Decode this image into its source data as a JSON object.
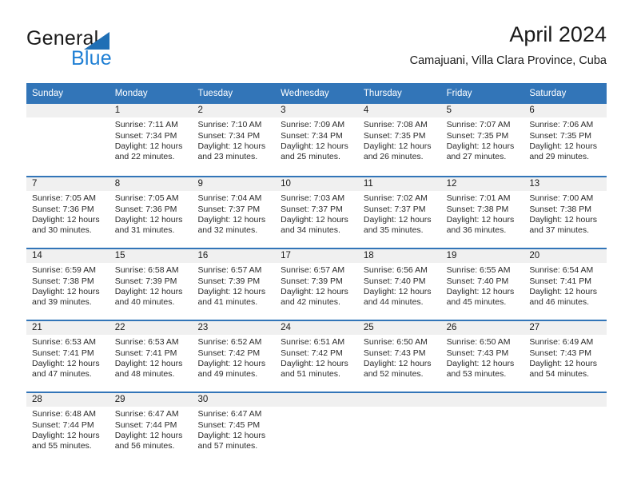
{
  "brand": {
    "name_dark": "General",
    "name_blue": "Blue",
    "triangle_color": "#1f6fb5",
    "blue_color": "#1f7fd4"
  },
  "header": {
    "title": "April 2024",
    "subtitle": "Camajuani, Villa Clara Province, Cuba"
  },
  "theme": {
    "header_blue": "#3275b8",
    "daynum_bg": "#f0f0f0",
    "text": "#1a1a1a"
  },
  "weekdays": [
    "Sunday",
    "Monday",
    "Tuesday",
    "Wednesday",
    "Thursday",
    "Friday",
    "Saturday"
  ],
  "weeks": [
    [
      {
        "day": "",
        "sunrise": "",
        "sunset": "",
        "daylight1": "",
        "daylight2": ""
      },
      {
        "day": "1",
        "sunrise": "Sunrise: 7:11 AM",
        "sunset": "Sunset: 7:34 PM",
        "daylight1": "Daylight: 12 hours",
        "daylight2": "and 22 minutes."
      },
      {
        "day": "2",
        "sunrise": "Sunrise: 7:10 AM",
        "sunset": "Sunset: 7:34 PM",
        "daylight1": "Daylight: 12 hours",
        "daylight2": "and 23 minutes."
      },
      {
        "day": "3",
        "sunrise": "Sunrise: 7:09 AM",
        "sunset": "Sunset: 7:34 PM",
        "daylight1": "Daylight: 12 hours",
        "daylight2": "and 25 minutes."
      },
      {
        "day": "4",
        "sunrise": "Sunrise: 7:08 AM",
        "sunset": "Sunset: 7:35 PM",
        "daylight1": "Daylight: 12 hours",
        "daylight2": "and 26 minutes."
      },
      {
        "day": "5",
        "sunrise": "Sunrise: 7:07 AM",
        "sunset": "Sunset: 7:35 PM",
        "daylight1": "Daylight: 12 hours",
        "daylight2": "and 27 minutes."
      },
      {
        "day": "6",
        "sunrise": "Sunrise: 7:06 AM",
        "sunset": "Sunset: 7:35 PM",
        "daylight1": "Daylight: 12 hours",
        "daylight2": "and 29 minutes."
      }
    ],
    [
      {
        "day": "7",
        "sunrise": "Sunrise: 7:05 AM",
        "sunset": "Sunset: 7:36 PM",
        "daylight1": "Daylight: 12 hours",
        "daylight2": "and 30 minutes."
      },
      {
        "day": "8",
        "sunrise": "Sunrise: 7:05 AM",
        "sunset": "Sunset: 7:36 PM",
        "daylight1": "Daylight: 12 hours",
        "daylight2": "and 31 minutes."
      },
      {
        "day": "9",
        "sunrise": "Sunrise: 7:04 AM",
        "sunset": "Sunset: 7:37 PM",
        "daylight1": "Daylight: 12 hours",
        "daylight2": "and 32 minutes."
      },
      {
        "day": "10",
        "sunrise": "Sunrise: 7:03 AM",
        "sunset": "Sunset: 7:37 PM",
        "daylight1": "Daylight: 12 hours",
        "daylight2": "and 34 minutes."
      },
      {
        "day": "11",
        "sunrise": "Sunrise: 7:02 AM",
        "sunset": "Sunset: 7:37 PM",
        "daylight1": "Daylight: 12 hours",
        "daylight2": "and 35 minutes."
      },
      {
        "day": "12",
        "sunrise": "Sunrise: 7:01 AM",
        "sunset": "Sunset: 7:38 PM",
        "daylight1": "Daylight: 12 hours",
        "daylight2": "and 36 minutes."
      },
      {
        "day": "13",
        "sunrise": "Sunrise: 7:00 AM",
        "sunset": "Sunset: 7:38 PM",
        "daylight1": "Daylight: 12 hours",
        "daylight2": "and 37 minutes."
      }
    ],
    [
      {
        "day": "14",
        "sunrise": "Sunrise: 6:59 AM",
        "sunset": "Sunset: 7:38 PM",
        "daylight1": "Daylight: 12 hours",
        "daylight2": "and 39 minutes."
      },
      {
        "day": "15",
        "sunrise": "Sunrise: 6:58 AM",
        "sunset": "Sunset: 7:39 PM",
        "daylight1": "Daylight: 12 hours",
        "daylight2": "and 40 minutes."
      },
      {
        "day": "16",
        "sunrise": "Sunrise: 6:57 AM",
        "sunset": "Sunset: 7:39 PM",
        "daylight1": "Daylight: 12 hours",
        "daylight2": "and 41 minutes."
      },
      {
        "day": "17",
        "sunrise": "Sunrise: 6:57 AM",
        "sunset": "Sunset: 7:39 PM",
        "daylight1": "Daylight: 12 hours",
        "daylight2": "and 42 minutes."
      },
      {
        "day": "18",
        "sunrise": "Sunrise: 6:56 AM",
        "sunset": "Sunset: 7:40 PM",
        "daylight1": "Daylight: 12 hours",
        "daylight2": "and 44 minutes."
      },
      {
        "day": "19",
        "sunrise": "Sunrise: 6:55 AM",
        "sunset": "Sunset: 7:40 PM",
        "daylight1": "Daylight: 12 hours",
        "daylight2": "and 45 minutes."
      },
      {
        "day": "20",
        "sunrise": "Sunrise: 6:54 AM",
        "sunset": "Sunset: 7:41 PM",
        "daylight1": "Daylight: 12 hours",
        "daylight2": "and 46 minutes."
      }
    ],
    [
      {
        "day": "21",
        "sunrise": "Sunrise: 6:53 AM",
        "sunset": "Sunset: 7:41 PM",
        "daylight1": "Daylight: 12 hours",
        "daylight2": "and 47 minutes."
      },
      {
        "day": "22",
        "sunrise": "Sunrise: 6:53 AM",
        "sunset": "Sunset: 7:41 PM",
        "daylight1": "Daylight: 12 hours",
        "daylight2": "and 48 minutes."
      },
      {
        "day": "23",
        "sunrise": "Sunrise: 6:52 AM",
        "sunset": "Sunset: 7:42 PM",
        "daylight1": "Daylight: 12 hours",
        "daylight2": "and 49 minutes."
      },
      {
        "day": "24",
        "sunrise": "Sunrise: 6:51 AM",
        "sunset": "Sunset: 7:42 PM",
        "daylight1": "Daylight: 12 hours",
        "daylight2": "and 51 minutes."
      },
      {
        "day": "25",
        "sunrise": "Sunrise: 6:50 AM",
        "sunset": "Sunset: 7:43 PM",
        "daylight1": "Daylight: 12 hours",
        "daylight2": "and 52 minutes."
      },
      {
        "day": "26",
        "sunrise": "Sunrise: 6:50 AM",
        "sunset": "Sunset: 7:43 PM",
        "daylight1": "Daylight: 12 hours",
        "daylight2": "and 53 minutes."
      },
      {
        "day": "27",
        "sunrise": "Sunrise: 6:49 AM",
        "sunset": "Sunset: 7:43 PM",
        "daylight1": "Daylight: 12 hours",
        "daylight2": "and 54 minutes."
      }
    ],
    [
      {
        "day": "28",
        "sunrise": "Sunrise: 6:48 AM",
        "sunset": "Sunset: 7:44 PM",
        "daylight1": "Daylight: 12 hours",
        "daylight2": "and 55 minutes."
      },
      {
        "day": "29",
        "sunrise": "Sunrise: 6:47 AM",
        "sunset": "Sunset: 7:44 PM",
        "daylight1": "Daylight: 12 hours",
        "daylight2": "and 56 minutes."
      },
      {
        "day": "30",
        "sunrise": "Sunrise: 6:47 AM",
        "sunset": "Sunset: 7:45 PM",
        "daylight1": "Daylight: 12 hours",
        "daylight2": "and 57 minutes."
      },
      {
        "day": "",
        "sunrise": "",
        "sunset": "",
        "daylight1": "",
        "daylight2": ""
      },
      {
        "day": "",
        "sunrise": "",
        "sunset": "",
        "daylight1": "",
        "daylight2": ""
      },
      {
        "day": "",
        "sunrise": "",
        "sunset": "",
        "daylight1": "",
        "daylight2": ""
      },
      {
        "day": "",
        "sunrise": "",
        "sunset": "",
        "daylight1": "",
        "daylight2": ""
      }
    ]
  ]
}
